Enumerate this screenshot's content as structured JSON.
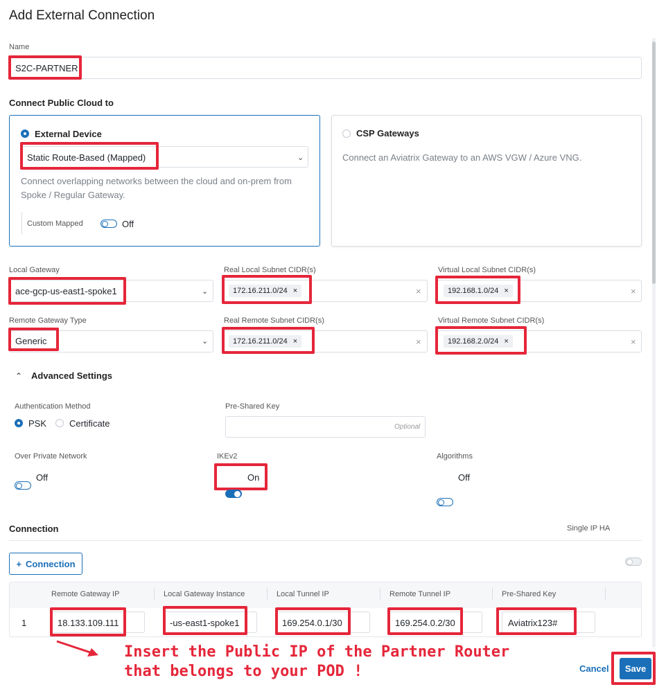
{
  "page": {
    "title": "Add External Connection"
  },
  "name_field": {
    "label": "Name",
    "value": "S2C-PARTNER"
  },
  "connect": {
    "heading": "Connect Public Cloud to",
    "external": {
      "title": "External Device",
      "type_value": "Static Route-Based (Mapped)",
      "description": "Connect overlapping networks between the cloud and on-prem from Spoke / Regular Gateway.",
      "custom_mapped_label": "Custom Mapped",
      "custom_mapped_state": "Off"
    },
    "csp": {
      "title": "CSP Gateways",
      "description": "Connect an Aviatrix Gateway to an AWS VGW / Azure VNG."
    }
  },
  "local_gateway": {
    "label": "Local Gateway",
    "value": "ace-gcp-us-east1-spoke1"
  },
  "real_local": {
    "label": "Real Local Subnet CIDR(s)",
    "chip": "172.16.211.0/24"
  },
  "virtual_local": {
    "label": "Virtual Local Subnet CIDR(s)",
    "chip": "192.168.1.0/24"
  },
  "remote_type": {
    "label": "Remote Gateway Type",
    "value": "Generic"
  },
  "real_remote": {
    "label": "Real Remote Subnet CIDR(s)",
    "chip": "172.16.211.0/24"
  },
  "virtual_remote": {
    "label": "Virtual Remote Subnet CIDR(s)",
    "chip": "192.168.2.0/24"
  },
  "advanced": {
    "title": "Advanced Settings",
    "auth_label": "Authentication Method",
    "auth_psk": "PSK",
    "auth_cert": "Certificate",
    "psk_label": "Pre-Shared Key",
    "psk_placeholder": "Optional",
    "private_label": "Over Private Network",
    "private_state": "Off",
    "ikev2_label": "IKEv2",
    "ikev2_state": "On",
    "algo_label": "Algorithms",
    "algo_state": "Off"
  },
  "connection": {
    "title": "Connection",
    "single_ip_ha": "Single IP HA",
    "add_label": "Connection",
    "columns": [
      "Remote Gateway IP",
      "Local Gateway Instance",
      "Local Tunnel IP",
      "Remote Tunnel IP",
      "Pre-Shared Key"
    ],
    "row": {
      "index": "1",
      "remote_gw_ip": "18.133.109.111",
      "local_gw_instance": "-us-east1-spoke1",
      "local_tunnel_ip": "169.254.0.1/30",
      "remote_tunnel_ip": "169.254.0.2/30",
      "psk": "Aviatrix123#"
    }
  },
  "annotation": {
    "line1": "Insert the Public IP of the Partner Router",
    "line2": "that belongs to your POD !"
  },
  "footer": {
    "cancel": "Cancel",
    "save": "Save"
  },
  "colors": {
    "accent": "#1a6fb8",
    "highlight": "#e5263a"
  }
}
